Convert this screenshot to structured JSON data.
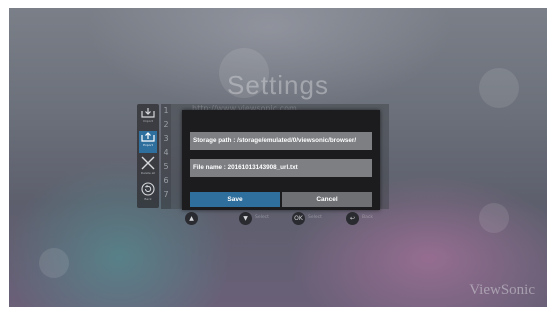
{
  "screen": {
    "title": "Settings",
    "brand": "ViewSonic"
  },
  "sidebar": {
    "items": [
      {
        "label": "Import",
        "icon": "import-icon"
      },
      {
        "label": "Export",
        "icon": "export-icon"
      },
      {
        "label": "Delete all",
        "icon": "delete-all-icon"
      },
      {
        "label": "Back",
        "icon": "back-icon"
      }
    ]
  },
  "url_list": {
    "numbers": [
      "1",
      "2",
      "3",
      "4",
      "5",
      "6",
      "7"
    ],
    "first_entry": "http://www.viewsonic.com"
  },
  "dialog": {
    "storage_path": "Storage path : /storage/emulated/0/viewsonic/browser/",
    "file_name": "File name : 20161013143908_url.txt",
    "save_label": "Save",
    "cancel_label": "Cancel"
  },
  "nav_hints": [
    {
      "key": "▲",
      "label": ""
    },
    {
      "key": "▼",
      "label": "Select"
    },
    {
      "key": "OK",
      "label": "Select"
    },
    {
      "key": "↩",
      "label": "Back"
    }
  ],
  "colors": {
    "save_button": "#2f6f9d",
    "cancel_button": "#6e7074",
    "field_bg": "#7d7f83",
    "dialog_bg": "#1c1c1e"
  }
}
